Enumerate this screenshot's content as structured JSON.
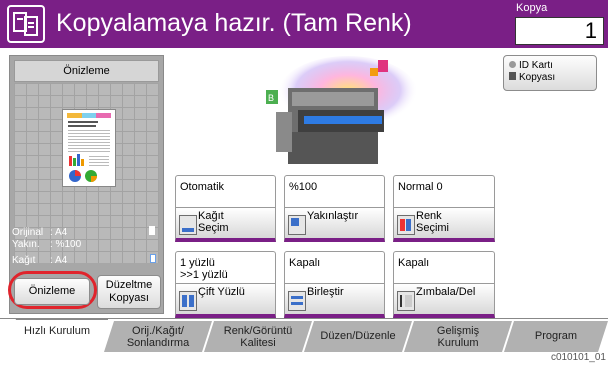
{
  "header": {
    "title": "Kopyalamaya hazır. (Tam Renk)",
    "copy_label": "Kopya",
    "copy_count": "1"
  },
  "preview": {
    "header_label": "Önizleme",
    "info": [
      {
        "label": "Orijinal",
        "value": ": A4"
      },
      {
        "label": "Yakın.",
        "value": ": %100"
      },
      {
        "label": "Kağıt",
        "value": ": A4"
      }
    ],
    "preview_button": "Önizleme",
    "fix_button_line1": "Düzeltme",
    "fix_button_line2": "Kopyası"
  },
  "id_card": {
    "line1": "ID Kartı",
    "line2": "Kopyası"
  },
  "functions": [
    {
      "value": "Otomatik",
      "label_line1": "Kağıt",
      "label_line2": "Seçim"
    },
    {
      "value": "%100",
      "label_line1": "Yakınlaştır",
      "label_line2": ""
    },
    {
      "value": "Normal 0",
      "label_line1": "Renk",
      "label_line2": "Seçimi"
    },
    {
      "value_line1": "1 yüzlü",
      "value_line2": ">>1 yüzlü",
      "label_line1": "Çift Yüzlü",
      "label_line2": ""
    },
    {
      "value": "Kapalı",
      "label_line1": "Birleştir",
      "label_line2": ""
    },
    {
      "value": "Kapalı",
      "label_line1": "Zımbala/Del",
      "label_line2": ""
    }
  ],
  "tabs": [
    {
      "line1": "Hızlı Kurulum",
      "line2": ""
    },
    {
      "line1": "Orij./Kağıt/",
      "line2": "Sonlandırma"
    },
    {
      "line1": "Renk/Görüntü",
      "line2": "Kalitesi"
    },
    {
      "line1": "Düzen/Düzenle",
      "line2": ""
    },
    {
      "line1": "Gelişmiş",
      "line2": "Kurulum"
    },
    {
      "line1": "Program",
      "line2": ""
    }
  ],
  "footer_code": "c010101_01",
  "colors": {
    "header": "#7a1f86",
    "highlight_ring": "#e0242c",
    "tab_bg": "#b1b1b1"
  }
}
